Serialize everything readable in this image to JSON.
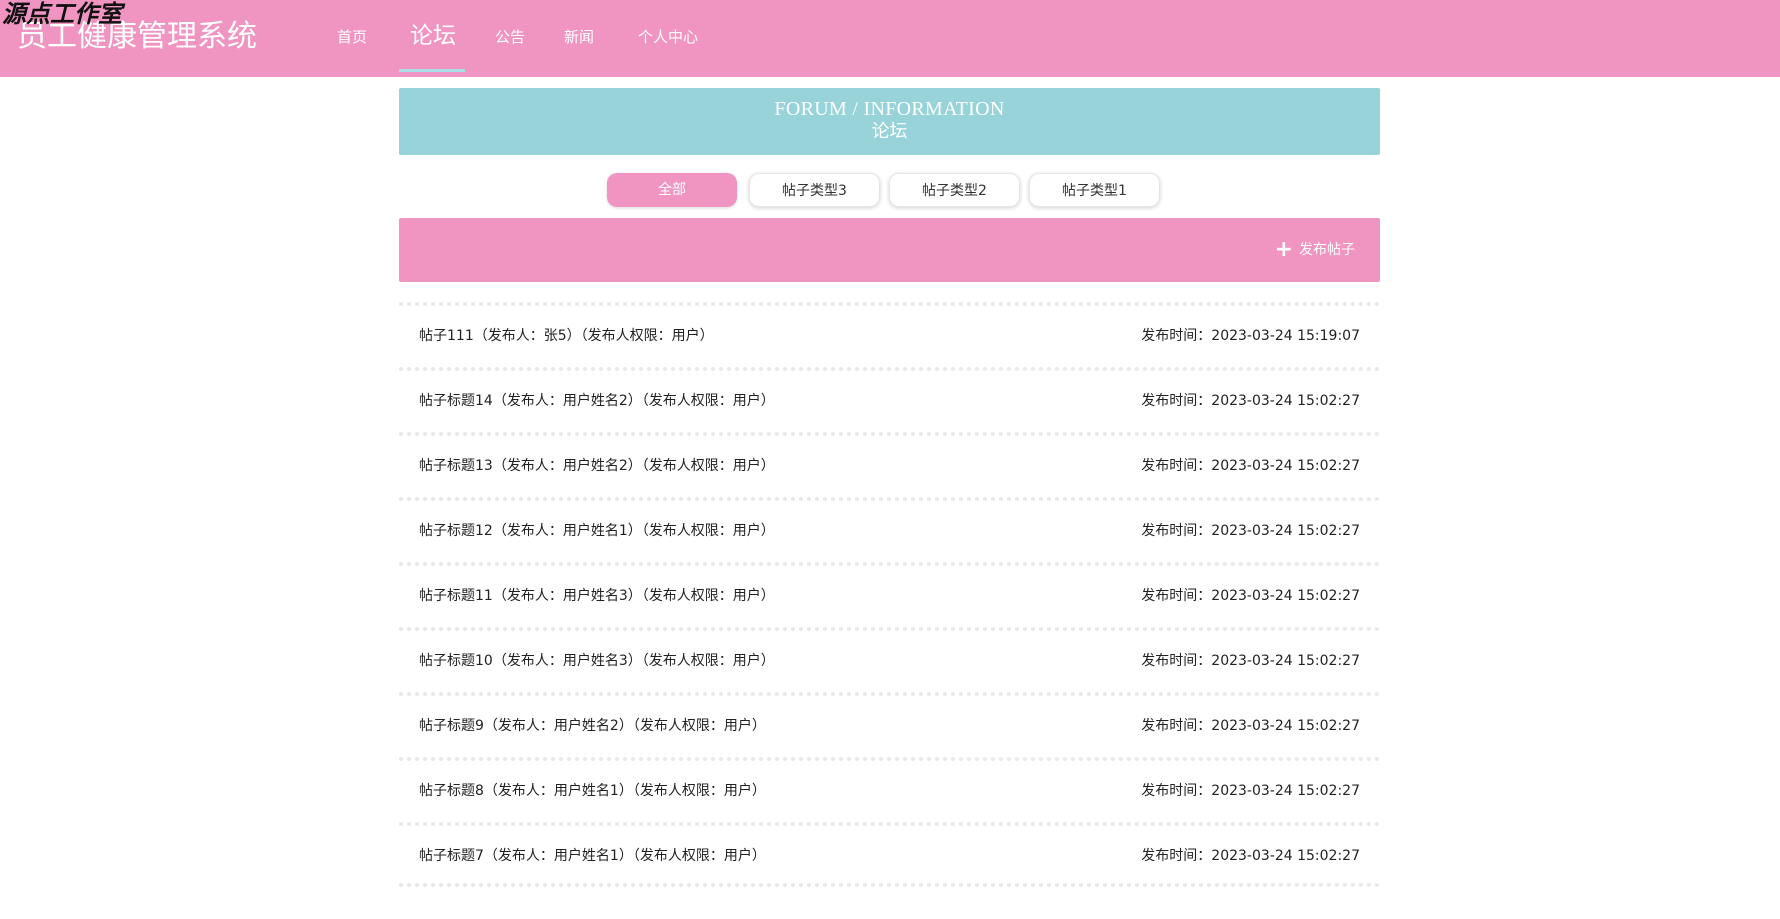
{
  "watermark": "源点工作室",
  "site_title": "员工健康管理系统",
  "nav": [
    {
      "label": "首页",
      "active": false
    },
    {
      "label": "论坛",
      "active": true
    },
    {
      "label": "公告",
      "active": false
    },
    {
      "label": "新闻",
      "active": false
    },
    {
      "label": "个人中心",
      "active": false
    }
  ],
  "banner": {
    "title_en": "FORUM / INFORMATION",
    "title_cn": "论坛"
  },
  "filters": [
    {
      "label": "全部",
      "active": true
    },
    {
      "label": "帖子类型3",
      "active": false
    },
    {
      "label": "帖子类型2",
      "active": false
    },
    {
      "label": "帖子类型1",
      "active": false
    }
  ],
  "action_bar": {
    "add_label": "发布帖子",
    "add_icon": "plus-icon"
  },
  "posts": [
    {
      "title": "帖子111（发布人：张5）（发布人权限：用户）",
      "time": "发布时间：2023-03-24 15:19:07"
    },
    {
      "title": "帖子标题14（发布人：用户姓名2）（发布人权限：用户）",
      "time": "发布时间：2023-03-24 15:02:27"
    },
    {
      "title": "帖子标题13（发布人：用户姓名2）（发布人权限：用户）",
      "time": "发布时间：2023-03-24 15:02:27"
    },
    {
      "title": "帖子标题12（发布人：用户姓名1）（发布人权限：用户）",
      "time": "发布时间：2023-03-24 15:02:27"
    },
    {
      "title": "帖子标题11（发布人：用户姓名3）（发布人权限：用户）",
      "time": "发布时间：2023-03-24 15:02:27"
    },
    {
      "title": "帖子标题10（发布人：用户姓名3）（发布人权限：用户）",
      "time": "发布时间：2023-03-24 15:02:27"
    },
    {
      "title": "帖子标题9（发布人：用户姓名2）（发布人权限：用户）",
      "time": "发布时间：2023-03-24 15:02:27"
    },
    {
      "title": "帖子标题8（发布人：用户姓名1）（发布人权限：用户）",
      "time": "发布时间：2023-03-24 15:02:27"
    },
    {
      "title": "帖子标题7（发布人：用户姓名1）（发布人权限：用户）",
      "time": "发布时间：2023-03-24 15:02:27"
    }
  ],
  "colors": {
    "primary_pink": "#f095c2",
    "banner_teal": "#97d3d9"
  }
}
